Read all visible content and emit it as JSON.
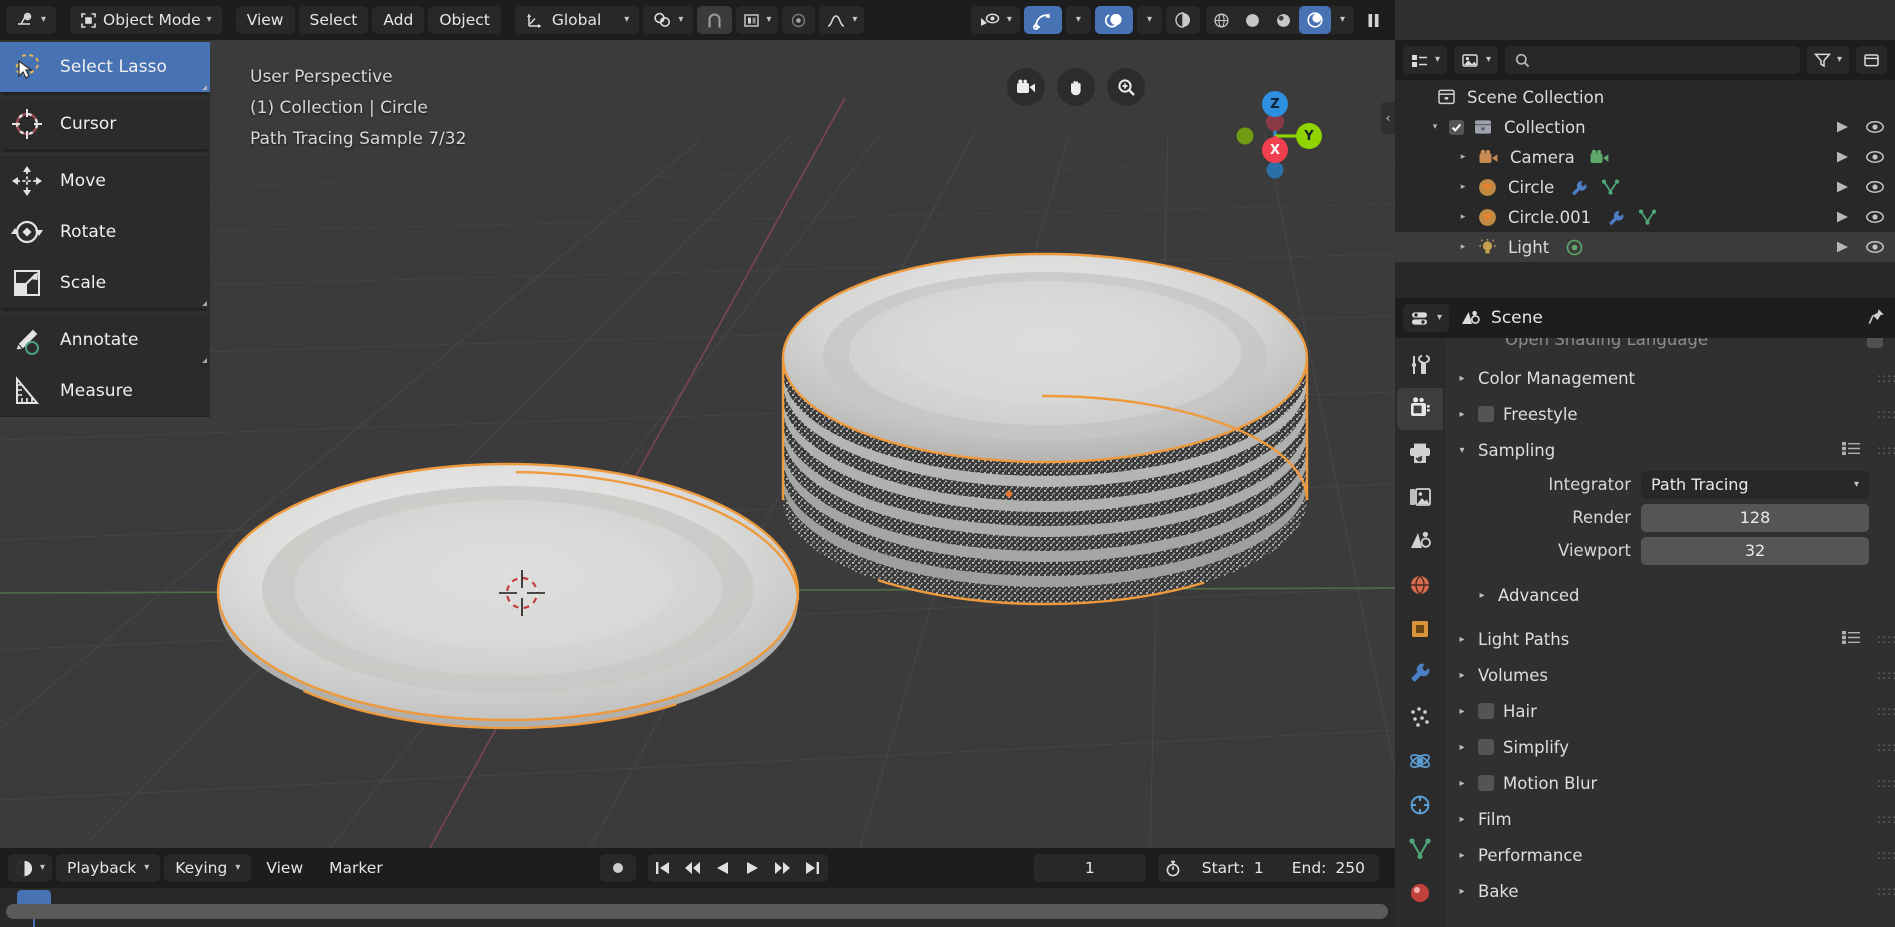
{
  "app": {
    "name": "Blender",
    "theme_accent": "#4772b3",
    "select_outline": "#ed9a3d"
  },
  "topbar": {
    "editor_type_icon": "editor-type-icon",
    "mode": {
      "label": "Object Mode",
      "icon": "object-mode-icon"
    },
    "menus": [
      {
        "name": "view",
        "label": "View"
      },
      {
        "name": "select",
        "label": "Select"
      },
      {
        "name": "add",
        "label": "Add"
      },
      {
        "name": "object",
        "label": "Object"
      }
    ],
    "transform_orientation": {
      "label": "Global",
      "icon": "orientation-axis-icon"
    },
    "pivot": {
      "icon": "pivot-point-icon"
    },
    "snap": {
      "icon": "magnet-icon",
      "enabled": false
    },
    "snap_target": {
      "icon": "snap-target-icon"
    },
    "proportional": {
      "icon": "proportional-edit-icon",
      "enabled": false
    },
    "falloff": {
      "icon": "falloff-curve-icon"
    },
    "visibility": {
      "icon": "object-visibility-icon"
    },
    "gizmo": {
      "icon": "gizmo-icon",
      "enabled": true
    },
    "overlays": {
      "icon": "overlays-icon",
      "enabled": true
    },
    "xray": {
      "icon": "xray-icon",
      "enabled": false
    },
    "shading": [
      {
        "name": "wireframe",
        "icon": "shading-wireframe-icon",
        "active": false
      },
      {
        "name": "solid",
        "icon": "shading-solid-icon",
        "active": false
      },
      {
        "name": "material-preview",
        "icon": "shading-material-icon",
        "active": false
      },
      {
        "name": "rendered",
        "icon": "shading-rendered-icon",
        "active": true
      }
    ],
    "pause_render": {
      "icon": "pause-icon"
    }
  },
  "toolbar": {
    "tools": [
      {
        "name": "select-lasso",
        "label": "Select Lasso",
        "icon": "lasso-select-icon",
        "active": true,
        "has_submenu": true
      },
      {
        "name": "cursor",
        "label": "Cursor",
        "icon": "cursor-3d-icon",
        "active": false,
        "has_submenu": false
      },
      {
        "name": "move",
        "label": "Move",
        "icon": "move-icon",
        "active": false,
        "has_submenu": false
      },
      {
        "name": "rotate",
        "label": "Rotate",
        "icon": "rotate-icon",
        "active": false,
        "has_submenu": false
      },
      {
        "name": "scale",
        "label": "Scale",
        "icon": "scale-icon",
        "active": false,
        "has_submenu": true
      },
      {
        "name": "annotate",
        "label": "Annotate",
        "icon": "annotate-pencil-icon",
        "active": false,
        "has_submenu": true
      },
      {
        "name": "measure",
        "label": "Measure",
        "icon": "measure-ruler-icon",
        "active": false,
        "has_submenu": false
      }
    ]
  },
  "viewport": {
    "overlay_lines": [
      "User Perspective",
      "(1) Collection | Circle",
      "Path Tracing Sample 7/32"
    ],
    "nav_buttons": [
      {
        "name": "toggle-camera-view",
        "icon": "camera-view-icon"
      },
      {
        "name": "move-view",
        "icon": "hand-icon"
      },
      {
        "name": "zoom-view",
        "icon": "zoom-magnifier-icon"
      }
    ],
    "gizmo_axes": [
      {
        "name": "z-positive",
        "label": "Z",
        "color": "#2e8fe0"
      },
      {
        "name": "y-positive",
        "label": "Y",
        "color": "#8fd300"
      },
      {
        "name": "x-positive",
        "label": "X",
        "color": "#f0404f"
      },
      {
        "name": "z-negative",
        "label": "",
        "color": "#2a6fa8"
      },
      {
        "name": "y-negative",
        "label": "",
        "color": "#6f9c12"
      },
      {
        "name": "x-negative",
        "label": "",
        "color": "#a33540"
      }
    ],
    "sidebar_toggle": {
      "name": "sidebar-toggle",
      "glyph": "‹"
    }
  },
  "timeline": {
    "editor_icon": "timeline-editor-icon",
    "menus": [
      {
        "name": "playback",
        "label": "Playback",
        "has_chevron": true
      },
      {
        "name": "keying",
        "label": "Keying",
        "has_chevron": true
      },
      {
        "name": "view",
        "label": "View",
        "has_chevron": false
      },
      {
        "name": "marker",
        "label": "Marker",
        "has_chevron": false
      }
    ],
    "record_button": {
      "name": "auto-keying",
      "icon": "record-dot-icon"
    },
    "transport": [
      {
        "name": "jump-to-start",
        "icon": "jump-start-icon"
      },
      {
        "name": "previous-keyframe",
        "icon": "prev-keyframe-icon"
      },
      {
        "name": "play-reverse",
        "icon": "play-reverse-icon"
      },
      {
        "name": "play",
        "icon": "play-icon"
      },
      {
        "name": "next-keyframe",
        "icon": "next-keyframe-icon"
      },
      {
        "name": "jump-to-end",
        "icon": "jump-end-icon"
      }
    ],
    "current_frame": "1",
    "use_preview_range_icon": "stopwatch-icon",
    "start_label": "Start:",
    "start_value": "1",
    "end_label": "End:",
    "end_value": "250"
  },
  "outliner": {
    "display_mode_icon": "outliner-display-mode-icon",
    "filter_id_icon": "outliner-id-type-icon",
    "search": {
      "placeholder": "",
      "value": "",
      "icon": "search-icon"
    },
    "filter_icon": "funnel-icon",
    "new_collection_icon": "new-collection-icon",
    "root": {
      "label": "Scene Collection",
      "icon": "scene-collection-icon"
    },
    "rows": [
      {
        "name": "collection",
        "label": "Collection",
        "icon": "collection-icon",
        "indent": 1,
        "disclosure": "open",
        "checkbox": true,
        "selected": false,
        "badges": []
      },
      {
        "name": "camera",
        "label": "Camera",
        "icon": "camera-object-icon",
        "indent": 2,
        "disclosure": "closed",
        "checkbox": false,
        "selected": false,
        "badges": [
          "camera-data-icon"
        ]
      },
      {
        "name": "circle",
        "label": "Circle",
        "icon": "mesh-object-icon",
        "indent": 2,
        "disclosure": "closed",
        "checkbox": false,
        "selected": false,
        "badges": [
          "modifier-icon",
          "mesh-data-icon"
        ]
      },
      {
        "name": "circle-001",
        "label": "Circle.001",
        "icon": "mesh-object-icon",
        "indent": 2,
        "disclosure": "closed",
        "checkbox": false,
        "selected": false,
        "badges": [
          "modifier-icon",
          "mesh-data-icon"
        ]
      },
      {
        "name": "light",
        "label": "Light",
        "icon": "light-object-icon",
        "indent": 2,
        "disclosure": "closed",
        "checkbox": false,
        "selected": true,
        "badges": [
          "light-data-icon"
        ]
      }
    ],
    "row_controls": {
      "restrict_render_icon": "render-arrow-icon",
      "hide_icon": "eye-icon"
    }
  },
  "properties": {
    "editor_icon": "properties-editor-icon",
    "breadcrumb": {
      "icon": "scene-icon",
      "label": "Scene"
    },
    "pin_icon": "pin-icon",
    "tabs": [
      {
        "name": "tool",
        "icon": "tool-screwdriver-wrench-icon",
        "active": false
      },
      {
        "name": "render",
        "icon": "render-camera-back-icon",
        "active": true
      },
      {
        "name": "output",
        "icon": "output-printer-icon",
        "active": false
      },
      {
        "name": "view-layer",
        "icon": "view-layer-images-icon",
        "active": false
      },
      {
        "name": "scene",
        "icon": "scene-cone-icon",
        "active": false
      },
      {
        "name": "world",
        "icon": "world-globe-icon",
        "active": false
      },
      {
        "name": "object",
        "icon": "object-square-icon",
        "active": false
      },
      {
        "name": "modifiers",
        "icon": "wrench-icon",
        "active": false
      },
      {
        "name": "particles",
        "icon": "particles-icon",
        "active": false
      },
      {
        "name": "physics",
        "icon": "physics-orbit-icon",
        "active": false
      },
      {
        "name": "constraints",
        "icon": "constraints-icon",
        "active": false
      },
      {
        "name": "object-data",
        "icon": "data-triangle-icon",
        "active": false
      },
      {
        "name": "material",
        "icon": "material-sphere-icon",
        "active": false
      }
    ],
    "clipped_top_label": "Open Shading Language",
    "clipped_top_has_checkbox": true,
    "panels": [
      {
        "name": "color-management",
        "label": "Color Management",
        "state": "closed",
        "checkbox": false,
        "list_icon": false
      },
      {
        "name": "freestyle",
        "label": "Freestyle",
        "state": "closed",
        "checkbox": true,
        "list_icon": false
      },
      {
        "name": "sampling",
        "label": "Sampling",
        "state": "open",
        "checkbox": false,
        "list_icon": true
      }
    ],
    "sampling": {
      "integrator": {
        "label": "Integrator",
        "value": "Path Tracing"
      },
      "render": {
        "label": "Render",
        "value": "128"
      },
      "viewport": {
        "label": "Viewport",
        "value": "32"
      },
      "advanced": {
        "label": "Advanced",
        "state": "closed"
      }
    },
    "panels_after": [
      {
        "name": "light-paths",
        "label": "Light Paths",
        "state": "closed",
        "checkbox": false,
        "list_icon": true
      },
      {
        "name": "volumes",
        "label": "Volumes",
        "state": "closed",
        "checkbox": false,
        "list_icon": false
      },
      {
        "name": "hair",
        "label": "Hair",
        "state": "closed",
        "checkbox": true,
        "list_icon": false
      },
      {
        "name": "simplify",
        "label": "Simplify",
        "state": "closed",
        "checkbox": true,
        "list_icon": false
      },
      {
        "name": "motion-blur",
        "label": "Motion Blur",
        "state": "closed",
        "checkbox": true,
        "list_icon": false
      },
      {
        "name": "film",
        "label": "Film",
        "state": "closed",
        "checkbox": false,
        "list_icon": false
      },
      {
        "name": "performance",
        "label": "Performance",
        "state": "closed",
        "checkbox": false,
        "list_icon": false
      },
      {
        "name": "bake",
        "label": "Bake",
        "state": "closed",
        "checkbox": false,
        "list_icon": false
      }
    ]
  }
}
